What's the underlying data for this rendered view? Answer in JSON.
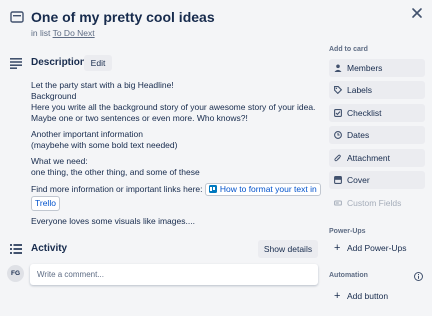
{
  "card": {
    "title": "One of my pretty cool ideas",
    "in_list_prefix": "in list",
    "list_name": "To Do Next"
  },
  "description": {
    "heading": "Description",
    "edit_label": "Edit",
    "lines": [
      "Let the party start with a big Headline!",
      "Background",
      "Here you write all the background story of your awesome story of your idea.",
      "Maybe one or two sentences or even more. Who knows?!",
      "Another important information",
      "(maybehe with some bold text needed)",
      "What we need:",
      "one thing, the other thing, and some of these",
      "Find more information or important links here:",
      "Everyone loves some visuals like images...."
    ],
    "link_text": "How to format your text in",
    "link_text_cont": "Trello"
  },
  "activity": {
    "heading": "Activity",
    "show_details_label": "Show details",
    "avatar_initials": "FG",
    "comment_placeholder": "Write a comment..."
  },
  "sidebar": {
    "add_to_card_label": "Add to card",
    "buttons": [
      {
        "label": "Members",
        "icon": "person-icon"
      },
      {
        "label": "Labels",
        "icon": "tag-icon"
      },
      {
        "label": "Checklist",
        "icon": "checklist-icon"
      },
      {
        "label": "Dates",
        "icon": "clock-icon"
      },
      {
        "label": "Attachment",
        "icon": "paperclip-icon"
      },
      {
        "label": "Cover",
        "icon": "cover-icon"
      },
      {
        "label": "Custom Fields",
        "icon": "custom-fields-icon",
        "disabled": true
      }
    ],
    "power_ups_label": "Power-Ups",
    "add_power_ups_label": "Add Power-Ups",
    "automation_label": "Automation",
    "add_button_label": "Add button"
  },
  "colors": {
    "background": "#f4f5f7",
    "button_bg": "#ebecf0",
    "text": "#172b4d",
    "muted": "#5e6c84",
    "link": "#0052cc"
  }
}
